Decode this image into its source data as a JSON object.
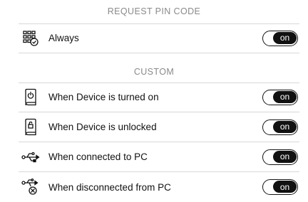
{
  "sections": {
    "request_pin": {
      "header": "REQUEST PIN CODE",
      "items": [
        {
          "label": "Always",
          "icon": "keypad-check-icon",
          "toggle": "on"
        }
      ]
    },
    "custom": {
      "header": "CUSTOM",
      "items": [
        {
          "label": "When Device is turned on",
          "icon": "device-power-icon",
          "toggle": "on"
        },
        {
          "label": "When Device is unlocked",
          "icon": "device-unlock-icon",
          "toggle": "on"
        },
        {
          "label": "When connected to PC",
          "icon": "usb-icon",
          "toggle": "on"
        },
        {
          "label": "When disconnected from PC",
          "icon": "usb-disconnect-icon",
          "toggle": "on"
        }
      ]
    }
  },
  "colors": {
    "toggle_on": "#111111",
    "header_text": "#8a8a8a",
    "divider": "#d8d8d8"
  }
}
